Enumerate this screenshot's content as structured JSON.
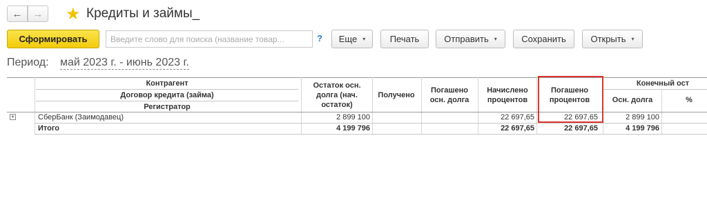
{
  "window": {
    "back_icon": "←",
    "forward_icon": "→",
    "favorite_icon": "★",
    "title": "Кредиты и займы_"
  },
  "toolbar": {
    "generate_label": "Сформировать",
    "search_placeholder": "Введите слово для поиска (название товар...",
    "help_label": "?",
    "more_label": "Еще",
    "print_label": "Печать",
    "send_label": "Отправить",
    "save_label": "Сохранить",
    "open_label": "Открыть",
    "caret": "▾"
  },
  "period": {
    "label": "Период:",
    "value": "май 2023 г. - июнь 2023 г."
  },
  "table": {
    "grouping_headers": [
      "Контрагент",
      "Договор кредита (займа)",
      "Регистратор"
    ],
    "col_opening_balance": "Остаток осн. долга (нач. остаток)",
    "col_received": "Получено",
    "col_repaid_principal": "Погашено осн. долга",
    "col_accrued_interest": "Начислено процентов",
    "col_repaid_interest": "Погашено процентов",
    "col_closing_group": "Конечный ост",
    "col_closing_principal": "Осн. долга",
    "col_closing_percent": "%",
    "expand_icon": "+",
    "rows": [
      {
        "name": "СберБанк (Заимодавец)",
        "opening_balance": "2 899 100",
        "received": "",
        "repaid_principal": "",
        "accrued_interest": "22 697,65",
        "repaid_interest": "22 697,65",
        "closing_principal": "2 899 100",
        "closing_percent": ""
      }
    ],
    "total": {
      "name": "Итого",
      "opening_balance": "4 199 796",
      "accrued_interest": "22 697,65",
      "repaid_interest": "22 697,65",
      "closing_principal": "4 199 796"
    }
  },
  "colors": {
    "accent_button": "#f2cb0b",
    "highlight_box": "#d9342b",
    "favorite_star": "#f2c200"
  }
}
